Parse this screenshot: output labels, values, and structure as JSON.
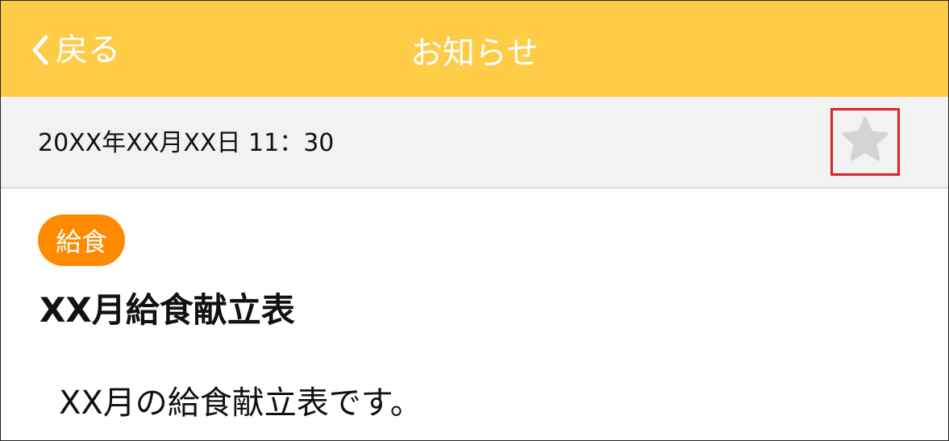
{
  "header": {
    "back_label": "戻る",
    "title": "お知らせ"
  },
  "notice": {
    "datetime": "20XX年XX月XX日 11：30",
    "favorite_icon": "star-icon",
    "category": "給食",
    "headline": "XX月給食献立表",
    "body": "XX月の給食献立表です。"
  },
  "colors": {
    "header_bg": "#fecc46",
    "category_bg": "#ff8a00",
    "highlight_border": "#e0202a",
    "star": "#d4d4d6"
  }
}
